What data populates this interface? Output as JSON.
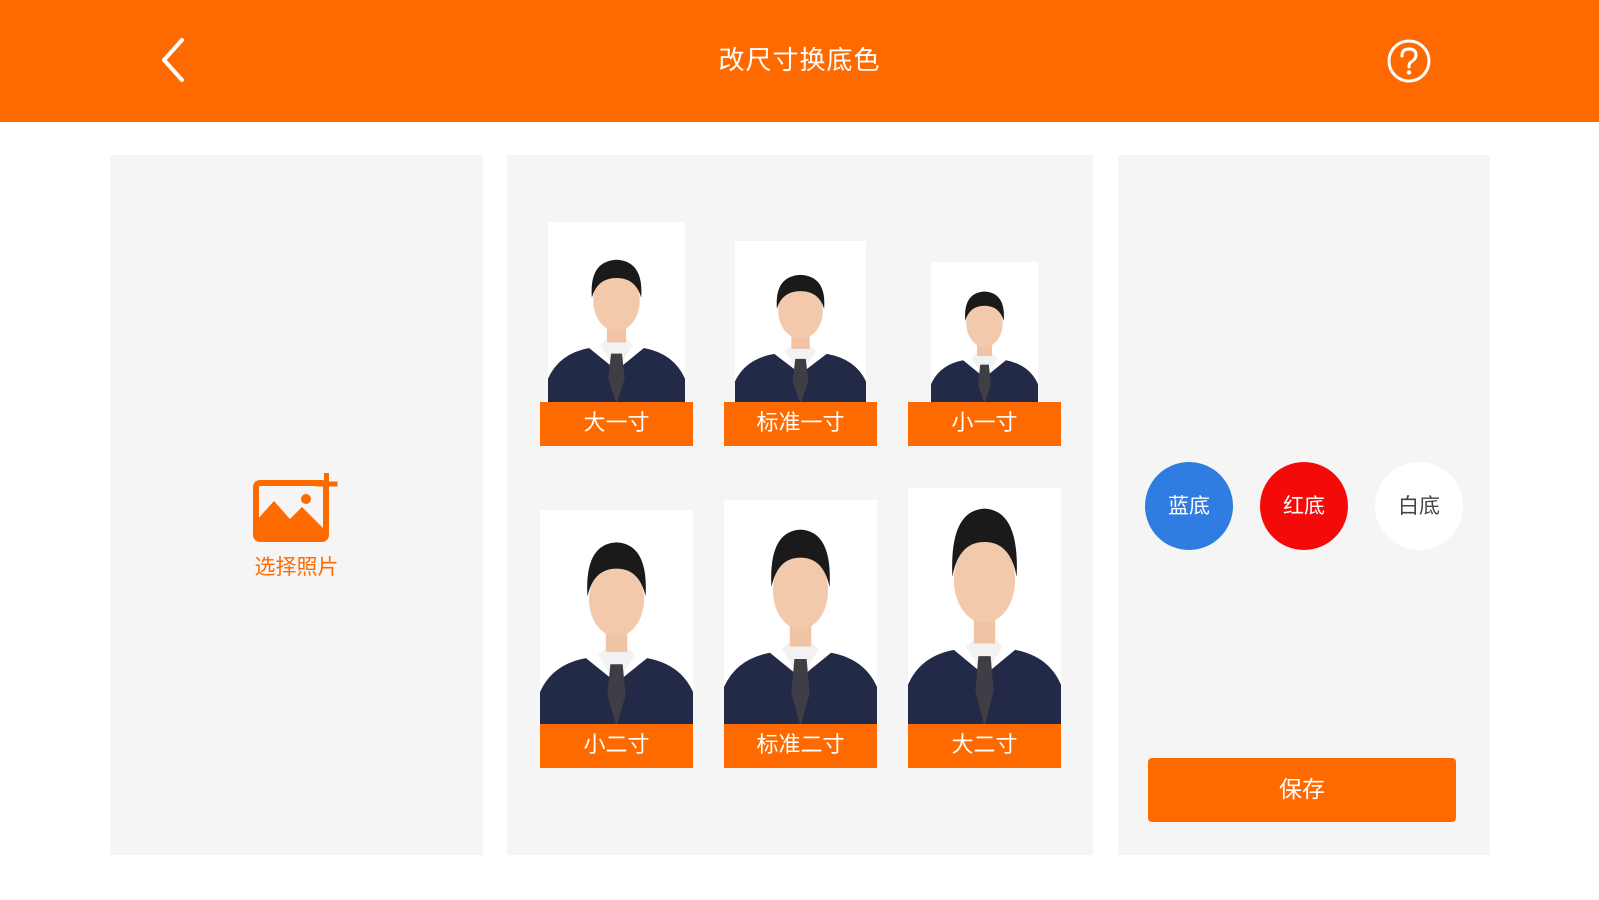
{
  "header": {
    "title": "改尺寸换底色"
  },
  "upload": {
    "label": "选择照片"
  },
  "sizes": [
    {
      "label": "大一寸"
    },
    {
      "label": "标准一寸"
    },
    {
      "label": "小一寸"
    },
    {
      "label": "小二寸"
    },
    {
      "label": "标准二寸"
    },
    {
      "label": "大二寸"
    }
  ],
  "background_colors": [
    {
      "label": "蓝底",
      "color": "#2f7de1"
    },
    {
      "label": "红底",
      "color": "#f50a0a"
    },
    {
      "label": "白底",
      "color": "#ffffff"
    }
  ],
  "actions": {
    "save_label": "保存"
  },
  "theme": {
    "accent": "#ff6a00",
    "panel_bg": "#f5f5f5",
    "suit": "#232a48"
  },
  "icons": {
    "back": "chevron-left-icon",
    "help": "question-circle-icon",
    "add_photo": "add-image-icon"
  }
}
